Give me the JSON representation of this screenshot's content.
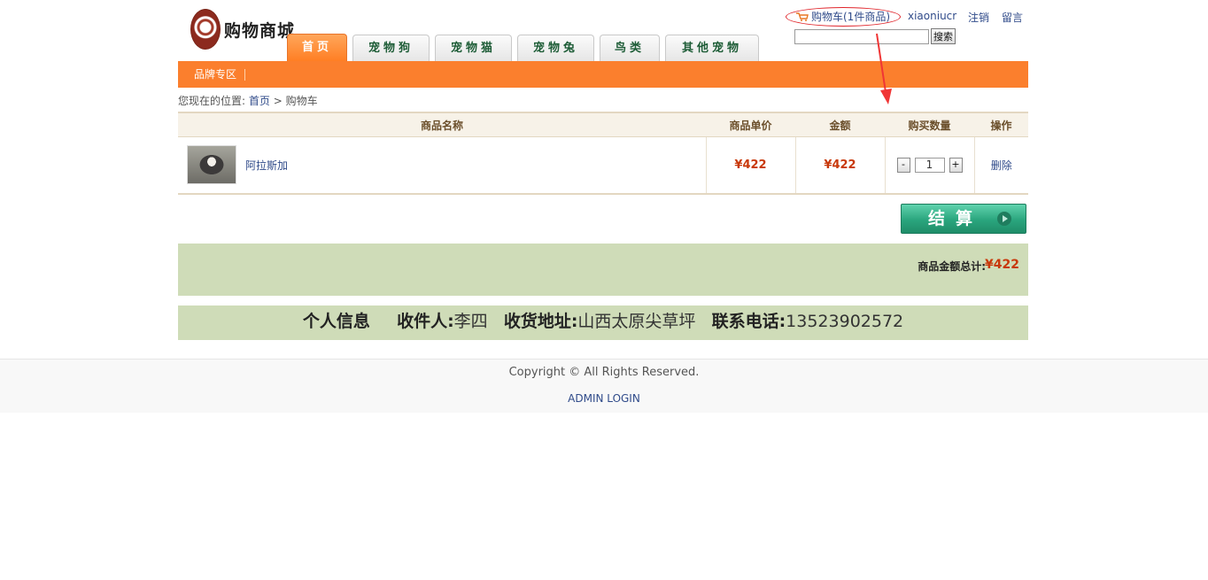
{
  "header": {
    "site_name": "购物商城",
    "tabs": [
      {
        "label": "首页",
        "active": true
      },
      {
        "label": "宠物狗",
        "active": false
      },
      {
        "label": "宠物猫",
        "active": false
      },
      {
        "label": "宠物兔",
        "active": false
      },
      {
        "label": "鸟类",
        "active": false
      },
      {
        "label": "其他宠物",
        "active": false
      }
    ],
    "cart_link": "购物车(1件商品)",
    "username": "xiaoniucr",
    "logout": "注销",
    "message": "留言",
    "search_value": "",
    "search_button": "搜索"
  },
  "navbar": {
    "brand_zone": "品牌专区"
  },
  "breadcrumb": {
    "prefix": "您现在的位置:",
    "home": "首页",
    "separator": ">",
    "current": "购物车"
  },
  "cart": {
    "columns": [
      "商品名称",
      "商品单价",
      "金额",
      "购买数量",
      "操作"
    ],
    "items": [
      {
        "name": "阿拉斯加",
        "unit_price": "¥422",
        "amount": "¥422",
        "quantity": "1",
        "minus": "-",
        "plus": "+",
        "delete": "删除"
      }
    ],
    "checkout": "结算",
    "total_label": "商品金额总计:",
    "total_value": "¥422"
  },
  "personal_info": {
    "title": "个人信息",
    "receiver_label": "收件人:",
    "receiver": "李四",
    "address_label": "收货地址:",
    "address": "山西太原尖草坪",
    "phone_label": "联系电话:",
    "phone": "13523902572"
  },
  "footer": {
    "copyright": "Copyright © All Rights Reserved.",
    "admin_login": "ADMIN LOGIN"
  },
  "colors": {
    "accent_orange": "#fb7f2d",
    "price_red": "#c8380a",
    "info_green": "#cfdcb8",
    "checkout_green": "#2aa57d"
  }
}
